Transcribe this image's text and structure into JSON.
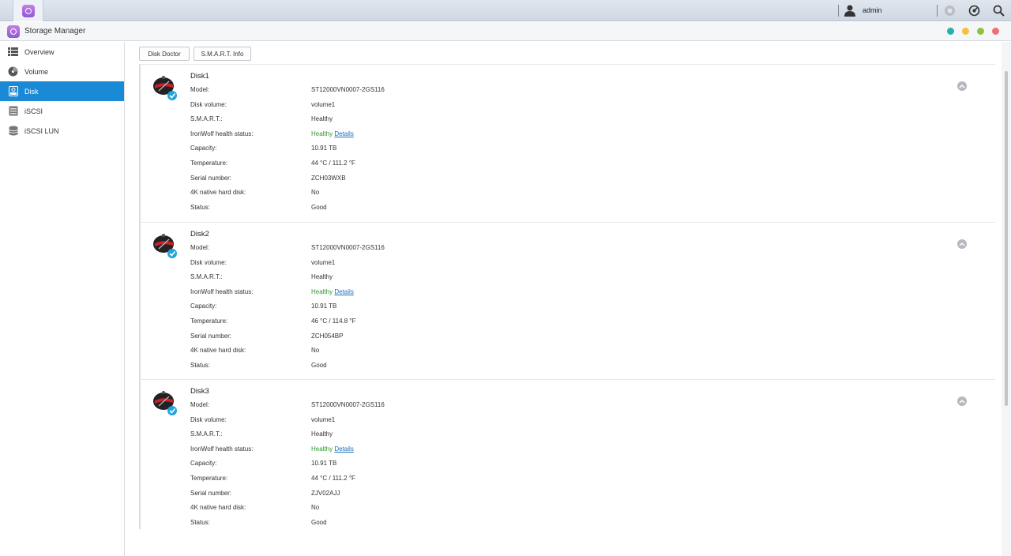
{
  "topbar": {
    "username": "admin",
    "icons": [
      "app-icon",
      "user-icon",
      "notification-icon",
      "dashboard-icon",
      "search-icon"
    ]
  },
  "window": {
    "title": "Storage Manager"
  },
  "sidebar": {
    "items": [
      {
        "label": "Overview",
        "icon": "list-icon"
      },
      {
        "label": "Volume",
        "icon": "volume-icon"
      },
      {
        "label": "Disk",
        "icon": "disk-icon",
        "active": true
      },
      {
        "label": "iSCSI",
        "icon": "iscsi-icon"
      },
      {
        "label": "iSCSI LUN",
        "icon": "lun-icon"
      }
    ]
  },
  "toolbar": {
    "disk_doctor": "Disk Doctor",
    "smart_info": "S.M.A.R.T. Info"
  },
  "labels": {
    "model": "Model:",
    "disk_volume": "Disk volume:",
    "smart": "S.M.A.R.T.:",
    "ironwolf": "IronWolf health status:",
    "capacity": "Capacity:",
    "temperature": "Temperature:",
    "serial": "Serial number:",
    "native4k": "4K native hard disk:",
    "status": "Status:",
    "details_link": "Details"
  },
  "disks": [
    {
      "name": "Disk1",
      "model": "ST12000VN0007-2GS116",
      "volume": "volume1",
      "smart": "Healthy",
      "ironwolf": "Healthy",
      "capacity": "10.91 TB",
      "temperature": "44 °C / 111.2 °F",
      "serial": "ZCH03WXB",
      "native4k": "No",
      "status": "Good"
    },
    {
      "name": "Disk2",
      "model": "ST12000VN0007-2GS116",
      "volume": "volume1",
      "smart": "Healthy",
      "ironwolf": "Healthy",
      "capacity": "10.91 TB",
      "temperature": "46 °C / 114.8 °F",
      "serial": "ZCH054BP",
      "native4k": "No",
      "status": "Good"
    },
    {
      "name": "Disk3",
      "model": "ST12000VN0007-2GS116",
      "volume": "volume1",
      "smart": "Healthy",
      "ironwolf": "Healthy",
      "capacity": "10.91 TB",
      "temperature": "44 °C / 111.2 °F",
      "serial": "ZJV02AJJ",
      "native4k": "No",
      "status": "Good"
    }
  ],
  "colors": {
    "accent": "#1a8ad6",
    "healthy": "#2b9b2b",
    "link": "#1a6fc2",
    "dot_teal": "#22b0b0",
    "dot_yellow": "#f2c33a",
    "dot_green": "#8dc43f",
    "dot_red": "#ef6f72"
  }
}
